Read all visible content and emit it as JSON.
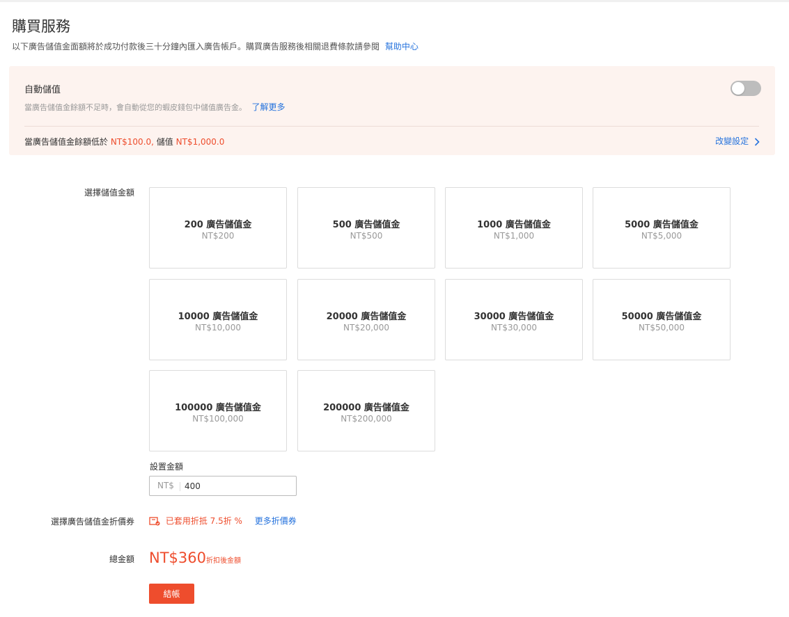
{
  "header": {
    "title": "購買服務",
    "subtitle": "以下廣告儲值金面額將於成功付款後三十分鐘內匯入廣告帳戶。購買廣告服務後相關退費條款請參閱",
    "help_link": "幫助中心"
  },
  "auto_topup": {
    "title": "自動儲值",
    "enabled": false,
    "description": "當廣告儲值金餘額不足時，會自動從您的蝦皮錢包中儲值廣告金。",
    "learn_more": "了解更多",
    "rule_prefix": "當廣告儲值金餘額低於",
    "threshold": "NT$100.0,",
    "rule_mid": "儲值",
    "topup_amount": "NT$1,000.0",
    "change_setting": "改變設定"
  },
  "select_amount": {
    "label": "選擇儲值金額",
    "options": [
      {
        "name": "200 廣告儲值金",
        "price": "NT$200"
      },
      {
        "name": "500 廣告儲值金",
        "price": "NT$500"
      },
      {
        "name": "1000 廣告儲值金",
        "price": "NT$1,000"
      },
      {
        "name": "5000 廣告儲值金",
        "price": "NT$5,000"
      },
      {
        "name": "10000 廣告儲值金",
        "price": "NT$10,000"
      },
      {
        "name": "20000 廣告儲值金",
        "price": "NT$20,000"
      },
      {
        "name": "30000 廣告儲值金",
        "price": "NT$30,000"
      },
      {
        "name": "50000 廣告儲值金",
        "price": "NT$50,000"
      },
      {
        "name": "100000 廣告儲值金",
        "price": "NT$100,000"
      },
      {
        "name": "200000 廣告儲值金",
        "price": "NT$200,000"
      }
    ]
  },
  "custom_amount": {
    "label": "設置金額",
    "prefix": "NT$",
    "value": "400"
  },
  "voucher": {
    "label": "選擇廣告儲值金折價券",
    "applied": "已套用折抵 7.5折 %",
    "more": "更多折價券"
  },
  "total": {
    "label": "總金額",
    "amount": "NT$360",
    "note": "折扣後金額"
  },
  "checkout": {
    "label": "結帳"
  },
  "colors": {
    "accent": "#ee4d2d",
    "link": "#2673dd",
    "panel_bg": "#fdf3ef"
  }
}
